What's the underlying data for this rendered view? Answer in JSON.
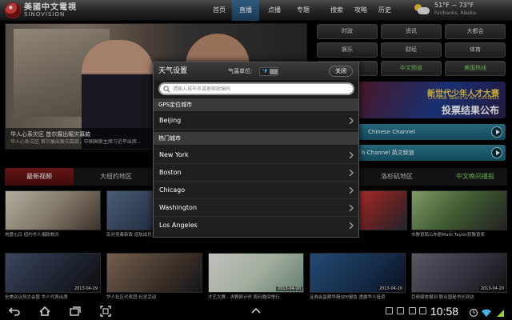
{
  "app": {
    "logo_cn": "美國中文電視",
    "logo_en": "SINOVISION"
  },
  "nav": {
    "items": [
      "首页",
      "直播",
      "点播",
      "专题",
      "搜索",
      "攻略",
      "历史"
    ],
    "active": "直播"
  },
  "weather": {
    "temp": "51°F ~ 73°F",
    "city": "Fairbanks, Alaska"
  },
  "hero": {
    "title": "华人心系灾区 首尔展出赈灾募款",
    "subtitle": "华人心系灾区 首尔展出赈灾募款，中国国家主席习近平出席..."
  },
  "categories": [
    "时政",
    "资讯",
    "大都会",
    "娱乐",
    "财经",
    "体育",
    "",
    "中文频道",
    "美国热线"
  ],
  "ad": {
    "line1": "新世代少年人才大赛",
    "line2": "Chinese Talent & Art Contests",
    "line3": "投票结果公布"
  },
  "channels": [
    {
      "label": "Chinese Channel"
    },
    {
      "label": "h Channel  英文频道"
    }
  ],
  "tabs": [
    "最新视频",
    "大纽约地区",
    "洛杉矶地区",
    "中文晚间播报"
  ],
  "thumbs": [
    {
      "caption": "地震七日 纽约华人捐款救灾",
      "date": ""
    },
    {
      "caption": "反对吴奏新政 巡航成员紧急集会",
      "date": ""
    },
    {
      "caption": "",
      "date": ""
    },
    {
      "caption": "",
      "date": ""
    },
    {
      "caption": "市教育局公布剧Mark Taylor获教育奖",
      "date": ""
    },
    {
      "caption": "全美众议员大会暨 华人代表出席",
      "date": "2013-04-29"
    },
    {
      "caption": "华人社区代表团 纪念活动",
      "date": ""
    },
    {
      "caption": "才艺大赛 : 决赛倒计时 周日晚间举行",
      "date": "2013-04-20"
    },
    {
      "caption": "证券会监察华裔SEP报告 透露华人投资",
      "date": "2013-04-20"
    },
    {
      "caption": "巨频媒体报到 联合国秘书长到访",
      "date": "2013-04-20"
    }
  ],
  "modal": {
    "title": "天气设置",
    "unit_label": "气温单位:",
    "unit_value": "°F",
    "close": "关闭",
    "search_placeholder": "请输入城市名或者邮政编码",
    "gps_header": "GPS定位城市",
    "gps_city": "Beijing",
    "hot_header": "热门城市",
    "hot_cities": [
      "New York",
      "Boston",
      "Chicago",
      "Washington",
      "Los Angeles"
    ]
  },
  "system": {
    "time": "10:58"
  },
  "colors": {
    "accent_blue": "#2d6896",
    "tab_red": "#6a1515",
    "green_text": "#7bd05b",
    "channel_teal": "#1f6d85",
    "unit_blue": "#44b4e8"
  }
}
